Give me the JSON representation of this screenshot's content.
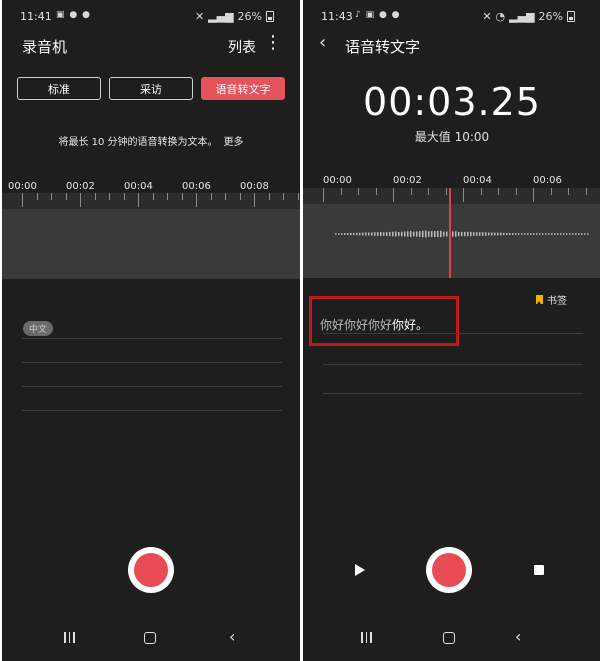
{
  "left": {
    "status": {
      "time": "11:41",
      "notif_icons": "▣ ● ●",
      "battery": "26%"
    },
    "title": "录音机",
    "list_label": "列表",
    "more_icon": "⋮",
    "modes": [
      "标准",
      "采访",
      "语音转文字"
    ],
    "info_text": "将最长 10 分钟的语音转换为文本。",
    "more_link": "更多",
    "ruler_labels": [
      "00:00",
      "00:02",
      "00:04",
      "00:06",
      "00:08"
    ],
    "language_chip": "中文"
  },
  "right": {
    "status": {
      "time": "11:43",
      "notif_icons": "♪ ▣ ● ●",
      "battery": "26%"
    },
    "title": "语音转文字",
    "timer": "00:03.25",
    "max_label": "最大值 10:00",
    "ruler_labels": [
      "00:00",
      "00:02",
      "00:04",
      "00:06"
    ],
    "bookmark_label": "书签",
    "transcript_faint": "你好你好你好",
    "transcript_main": "你好。"
  },
  "colors": {
    "accent": "#e6535c",
    "highlight_box": "#c21818",
    "background": "#1e1e1e",
    "bookmark": "#f0b400"
  },
  "icons": [
    "back-icon",
    "more-icon",
    "bookmark-icon",
    "play-icon",
    "stop-icon",
    "record-icon",
    "nav-recent-icon",
    "nav-home-icon",
    "nav-back-icon"
  ]
}
